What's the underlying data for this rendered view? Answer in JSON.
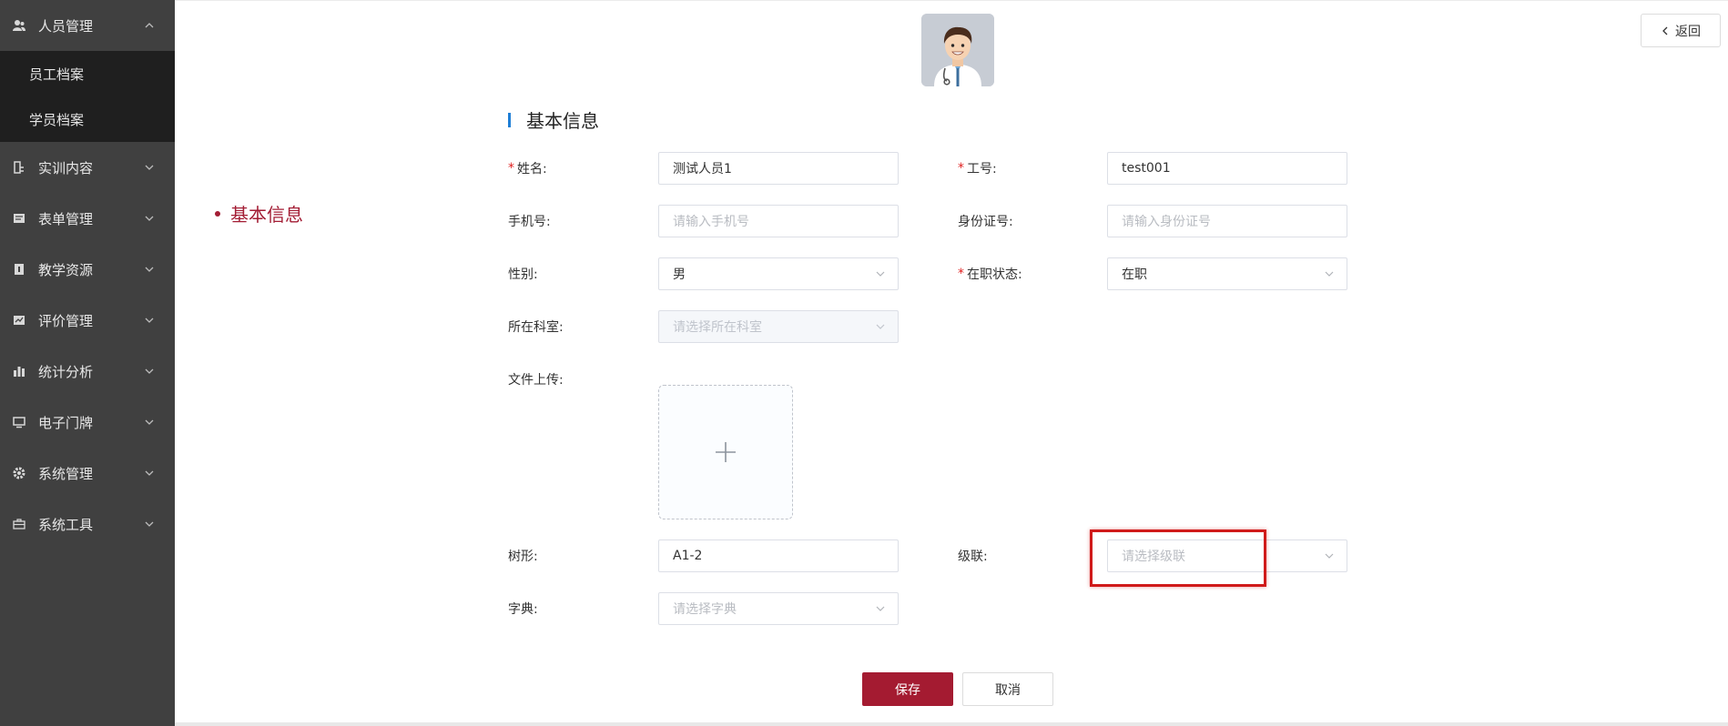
{
  "sidebar": {
    "items": [
      {
        "label": "人员管理",
        "icon": "people-icon",
        "expanded": true
      },
      {
        "label": "实训内容",
        "icon": "content-icon"
      },
      {
        "label": "表单管理",
        "icon": "form-icon"
      },
      {
        "label": "教学资源",
        "icon": "resource-icon"
      },
      {
        "label": "评价管理",
        "icon": "evaluation-icon"
      },
      {
        "label": "统计分析",
        "icon": "chart-icon"
      },
      {
        "label": "电子门牌",
        "icon": "monitor-icon"
      },
      {
        "label": "系统管理",
        "icon": "gear-icon"
      },
      {
        "label": "系统工具",
        "icon": "toolbox-icon"
      }
    ],
    "submenu": [
      "员工档案",
      "学员档案"
    ]
  },
  "header": {
    "back_label": "返回"
  },
  "anchor_nav": {
    "label": "基本信息"
  },
  "section": {
    "title": "基本信息"
  },
  "form": {
    "name": {
      "label": "姓名:",
      "required": true,
      "value": "测试人员1"
    },
    "employee_id": {
      "label": "工号:",
      "required": true,
      "value": "test001"
    },
    "phone": {
      "label": "手机号:",
      "placeholder": "请输入手机号"
    },
    "id_card": {
      "label": "身份证号:",
      "placeholder": "请输入身份证号"
    },
    "gender": {
      "label": "性别:",
      "value": "男"
    },
    "employment_status": {
      "label": "在职状态:",
      "required": true,
      "value": "在职"
    },
    "department": {
      "label": "所在科室:",
      "placeholder": "请选择所在科室",
      "disabled": true
    },
    "upload": {
      "label": "文件上传:"
    },
    "tree": {
      "label": "树形:",
      "value": "A1-2"
    },
    "cascade": {
      "label": "级联:",
      "placeholder": "请选择级联"
    },
    "dictionary": {
      "label": "字典:",
      "placeholder": "请选择字典"
    },
    "required_mark": "*"
  },
  "actions": {
    "save_label": "保存",
    "cancel_label": "取消"
  },
  "colors": {
    "sidebar_bg": "#404040",
    "submenu_bg": "#1f1f1f",
    "brand": "#a41b31",
    "section_bar": "#1f7fd6",
    "highlight": "#d01a1a"
  }
}
